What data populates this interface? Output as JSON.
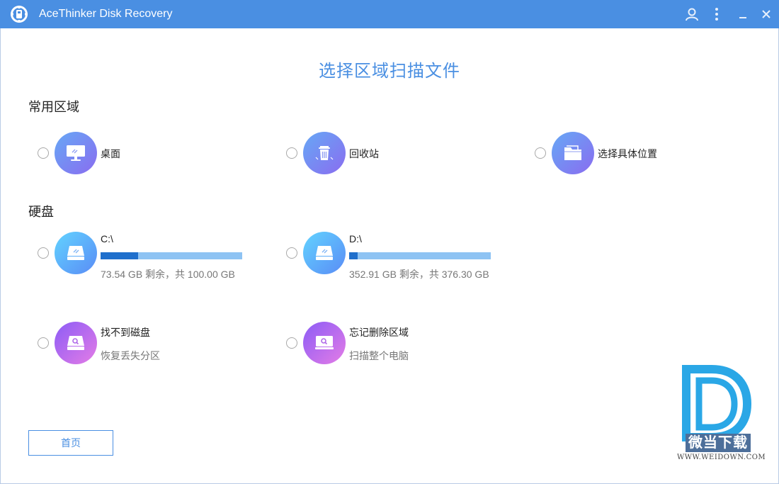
{
  "app": {
    "title": "AceThinker Disk Recovery"
  },
  "main": {
    "title": "选择区域扫描文件"
  },
  "common_area": {
    "heading": "常用区域",
    "items": [
      {
        "label": "桌面",
        "icon": "desktop-icon"
      },
      {
        "label": "回收站",
        "icon": "recycle-bin-icon"
      },
      {
        "label": "选择具体位置",
        "icon": "folder-icon"
      }
    ]
  },
  "disks": {
    "heading": "硬盘",
    "items": [
      {
        "label": "C:\\",
        "detail": "73.54 GB 剩余，共 100.00 GB",
        "used_fraction": 0.2646
      },
      {
        "label": "D:\\",
        "detail": "352.91 GB 剩余，共 376.30 GB",
        "used_fraction": 0.0622
      }
    ],
    "extra": [
      {
        "label": "找不到磁盘",
        "detail": "恢复丢失分区",
        "icon": "lost-disk-icon"
      },
      {
        "label": "忘记删除区域",
        "detail": "扫描整个电脑",
        "icon": "scan-computer-icon"
      }
    ]
  },
  "footer": {
    "home_label": "首页"
  },
  "watermark": {
    "text": "微当下载",
    "url": "WWW.WEIDOWN.COM"
  },
  "colors": {
    "accent": "#4a8fe2",
    "bar_fill": "#1f6fcc",
    "bar_track": "#8ec3f3"
  }
}
